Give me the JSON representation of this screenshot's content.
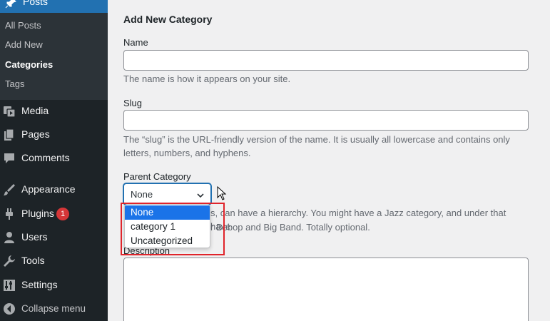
{
  "sidebar": {
    "posts_label": "Posts",
    "submenu": [
      {
        "label": "All Posts",
        "current": false
      },
      {
        "label": "Add New",
        "current": false
      },
      {
        "label": "Categories",
        "current": true
      },
      {
        "label": "Tags",
        "current": false
      }
    ],
    "menu": [
      {
        "label": "Media",
        "icon": "media-icon"
      },
      {
        "label": "Pages",
        "icon": "pages-icon"
      },
      {
        "label": "Comments",
        "icon": "comments-icon"
      },
      {
        "label": "Appearance",
        "icon": "appearance-icon"
      },
      {
        "label": "Plugins",
        "icon": "plugins-icon",
        "badge": "1"
      },
      {
        "label": "Users",
        "icon": "users-icon"
      },
      {
        "label": "Tools",
        "icon": "tools-icon"
      },
      {
        "label": "Settings",
        "icon": "settings-icon"
      },
      {
        "label": "Collapse menu",
        "icon": "collapse-icon"
      }
    ]
  },
  "form": {
    "title": "Add New Category",
    "name_label": "Name",
    "name_help": "The name is how it appears on your site.",
    "slug_label": "Slug",
    "slug_help": "The “slug” is the URL-friendly version of the name. It is usually all lowercase and contains only letters, numbers, and hyphens.",
    "parent_label": "Parent Category",
    "parent_value": "None",
    "parent_help_visible": "s, can have a hierarchy. You might have a Jazz category, and under that have",
    "parent_help_visible_2": "r Bebop and Big Band. Totally optional.",
    "description_label": "Description"
  },
  "dropdown": {
    "options": [
      "None",
      "category 1",
      "Uncategorized"
    ],
    "selected_index": 0
  },
  "colors": {
    "sidebar_bg": "#1d2327",
    "accent": "#2271b1",
    "highlight_border": "#e0242b",
    "badge_bg": "#d63638",
    "option_selected_bg": "#1a73e8"
  }
}
